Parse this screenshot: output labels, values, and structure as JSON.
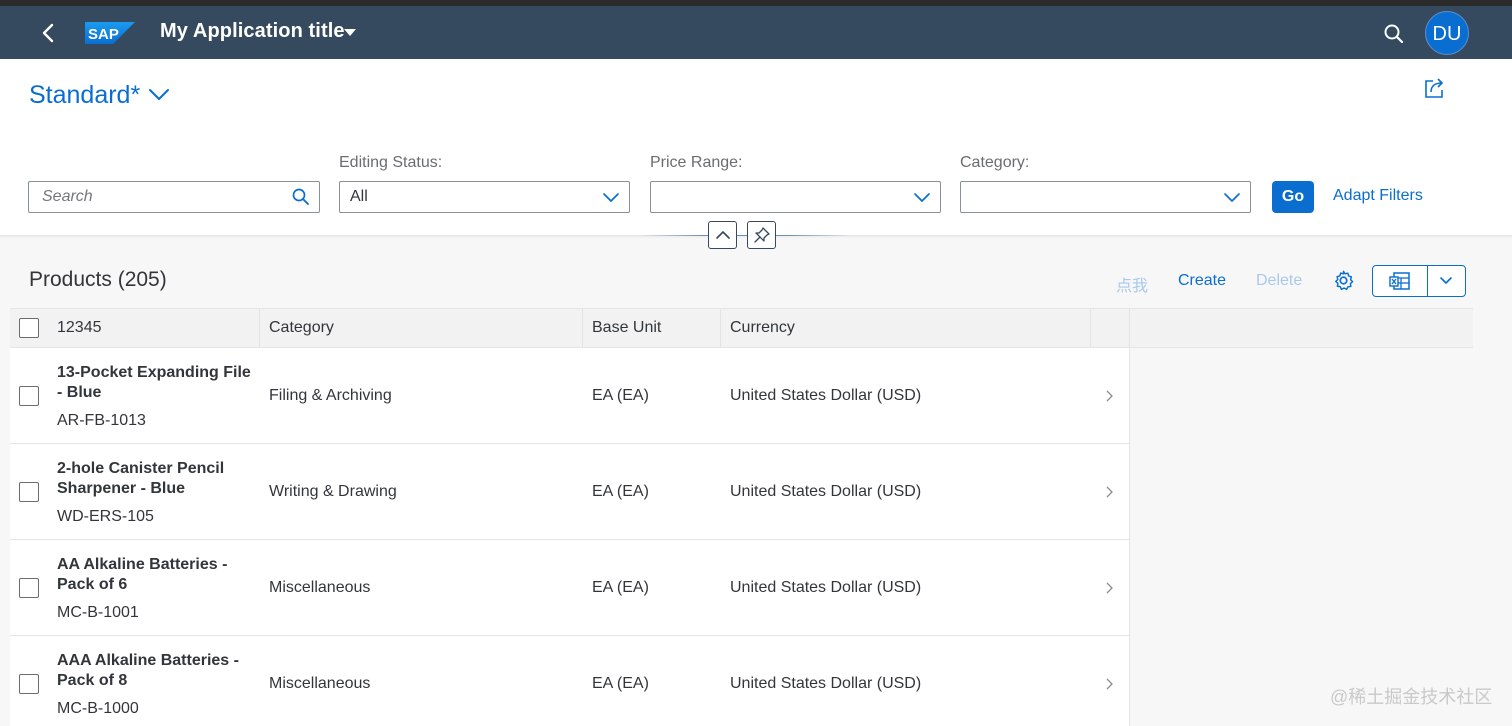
{
  "shell": {
    "title": "My Application title",
    "avatar_initials": "DU",
    "logo_icon": "sap-logo",
    "colors": {
      "bar": "#354a5f",
      "avatar": "#0a6ed1"
    }
  },
  "header": {
    "variant_name": "Standard*",
    "search": {
      "placeholder": "Search",
      "value": ""
    },
    "filters": [
      {
        "label": "Editing Status:",
        "value": "All"
      },
      {
        "label": "Price Range:",
        "value": ""
      },
      {
        "label": "Category:",
        "value": ""
      }
    ],
    "go_label": "Go",
    "adapt_filters_label": "Adapt Filters"
  },
  "table": {
    "title": "Products (205)",
    "toolbar": {
      "click_label": "点我",
      "create_label": "Create",
      "delete_label": "Delete"
    },
    "columns": [
      "12345",
      "Category",
      "Base Unit",
      "Currency"
    ],
    "rows": [
      {
        "name": "13-Pocket Expanding File - Blue",
        "code": "AR-FB-1013",
        "category": "Filing & Archiving",
        "unit": "EA (EA)",
        "currency": "United States Dollar (USD)"
      },
      {
        "name": "2-hole Canister Pencil Sharpener - Blue",
        "code": "WD-ERS-105",
        "category": "Writing & Drawing",
        "unit": "EA (EA)",
        "currency": "United States Dollar (USD)"
      },
      {
        "name": "AA Alkaline Batteries - Pack of 6",
        "code": "MC-B-1001",
        "category": "Miscellaneous",
        "unit": "EA (EA)",
        "currency": "United States Dollar (USD)"
      },
      {
        "name": "AAA Alkaline Batteries - Pack of 8",
        "code": "MC-B-1000",
        "category": "Miscellaneous",
        "unit": "EA (EA)",
        "currency": "United States Dollar (USD)"
      }
    ]
  },
  "watermark": "@稀土掘金技术社区"
}
